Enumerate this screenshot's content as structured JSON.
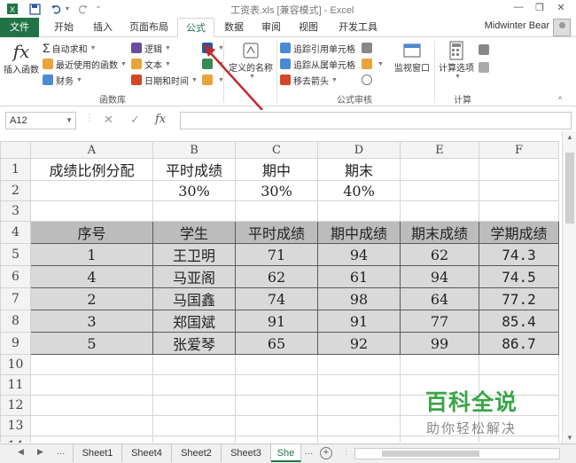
{
  "titlebar": {
    "title": "工资表.xls [兼容模式] - Excel",
    "minimize": "—",
    "restore": "❐",
    "close": "✕"
  },
  "tabs": [
    "文件",
    "开始",
    "插入",
    "页面布局",
    "公式",
    "数据",
    "审阅",
    "视图",
    "开发工具"
  ],
  "active_tab": "公式",
  "user_name": "Midwinter Bear",
  "ribbon": {
    "insert_function": "插入函数",
    "autosum": "自动求和",
    "recently_used": "最近使用的函数",
    "financial": "财务",
    "logical": "逻辑",
    "text": "文本",
    "date_time": "日期和时间",
    "function_library_label": "函数库",
    "defined_names": "定义的名称",
    "trace_precedents": "追踪引用单元格",
    "trace_dependents": "追踪从属单元格",
    "remove_arrows": "移去箭头",
    "formula_auditing_label": "公式审核",
    "watch_window": "监视窗口",
    "calc_options": "计算选项",
    "calculation_label": "计算"
  },
  "formula_bar": {
    "name_box": "A12",
    "fx": "fx",
    "formula": ""
  },
  "columns": [
    "A",
    "B",
    "C",
    "D",
    "E",
    "F"
  ],
  "row_numbers": [
    "1",
    "2",
    "3",
    "4",
    "5",
    "6",
    "7",
    "8",
    "9",
    "10",
    "11",
    "12",
    "13",
    "14"
  ],
  "cells": {
    "r1": [
      "成绩比例分配",
      "平时成绩",
      "期中",
      "期末",
      "",
      ""
    ],
    "r2": [
      "",
      "30%",
      "30%",
      "40%",
      "",
      ""
    ],
    "headers": [
      "序号",
      "学生",
      "平时成绩",
      "期中成绩",
      "期末成绩",
      "学期成绩"
    ],
    "rows": [
      [
        "1",
        "王卫明",
        "71",
        "94",
        "62",
        "74.3"
      ],
      [
        "4",
        "马亚阁",
        "62",
        "61",
        "94",
        "74.5"
      ],
      [
        "2",
        "马国鑫",
        "74",
        "98",
        "64",
        "77.2"
      ],
      [
        "3",
        "郑国斌",
        "91",
        "91",
        "77",
        "85.4"
      ],
      [
        "5",
        "张爱琴",
        "65",
        "92",
        "99",
        "86.7"
      ]
    ]
  },
  "sheet_tabs": [
    "Sheet1",
    "Sheet4",
    "Sheet2",
    "Sheet3",
    "She"
  ],
  "active_sheet": "She",
  "sheet_nav": {
    "prev": "◀",
    "next": "▶",
    "more": "...",
    "more_right": "...",
    "add": "+"
  },
  "watermark": {
    "main": "百科全说",
    "sub": "助你轻松解决"
  },
  "colors": {
    "excel_green": "#217346",
    "header_fill": "#bcbcbc",
    "data_fill": "#d9d9d9",
    "watermark_green": "#3aa547",
    "arrow_red": "#c0282d"
  }
}
